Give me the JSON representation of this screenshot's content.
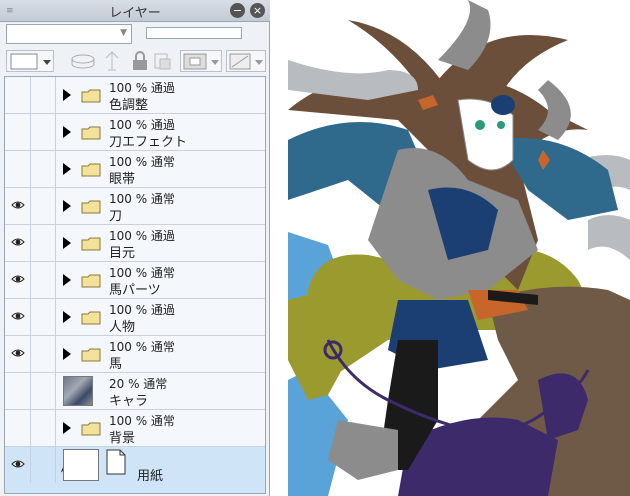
{
  "panel": {
    "title": "レイヤー",
    "grip_icon": "grip-icon",
    "minimize_icon": "minimize-icon",
    "close_icon": "close-icon"
  },
  "toolbar": {
    "blend_mode": "",
    "icons": [
      "color-swatch-icon",
      "new-layer-icon",
      "reference-icon",
      "lock-icon",
      "clip-icon",
      "mask-icon",
      "ruler-icon"
    ]
  },
  "layers": [
    {
      "visible": false,
      "type": "folder",
      "mode": "100 % 通過",
      "name": "色調整"
    },
    {
      "visible": false,
      "type": "folder",
      "mode": "100 % 通過",
      "name": "刀エフェクト"
    },
    {
      "visible": false,
      "type": "folder",
      "mode": "100 % 通常",
      "name": "眼帯"
    },
    {
      "visible": true,
      "type": "folder",
      "mode": "100 % 通常",
      "name": "刀"
    },
    {
      "visible": true,
      "type": "folder",
      "mode": "100 % 通過",
      "name": "目元"
    },
    {
      "visible": true,
      "type": "folder",
      "mode": "100 % 通常",
      "name": "馬パーツ"
    },
    {
      "visible": true,
      "type": "folder",
      "mode": "100 % 通過",
      "name": "人物"
    },
    {
      "visible": true,
      "type": "folder",
      "mode": "100 % 通常",
      "name": "馬"
    },
    {
      "visible": false,
      "type": "raster",
      "mode": "20 % 通常",
      "name": "キャラ"
    },
    {
      "visible": false,
      "type": "folder",
      "mode": "100 % 通常",
      "name": "背景"
    },
    {
      "visible": true,
      "type": "paper",
      "mode": "",
      "name": "用紙",
      "selected": true
    }
  ],
  "colors": {
    "hair": "#6b4f3a",
    "blue_dark": "#1b3f73",
    "blue_teal": "#2f6a8c",
    "gray": "#8c8c8c",
    "gray_light": "#b8bcc0",
    "olive": "#9a9a2e",
    "horse": "#6e5a46",
    "purple": "#3d2a6b",
    "sky": "#5aa3d8",
    "orange": "#c8652a",
    "black": "#1a1a1a"
  }
}
